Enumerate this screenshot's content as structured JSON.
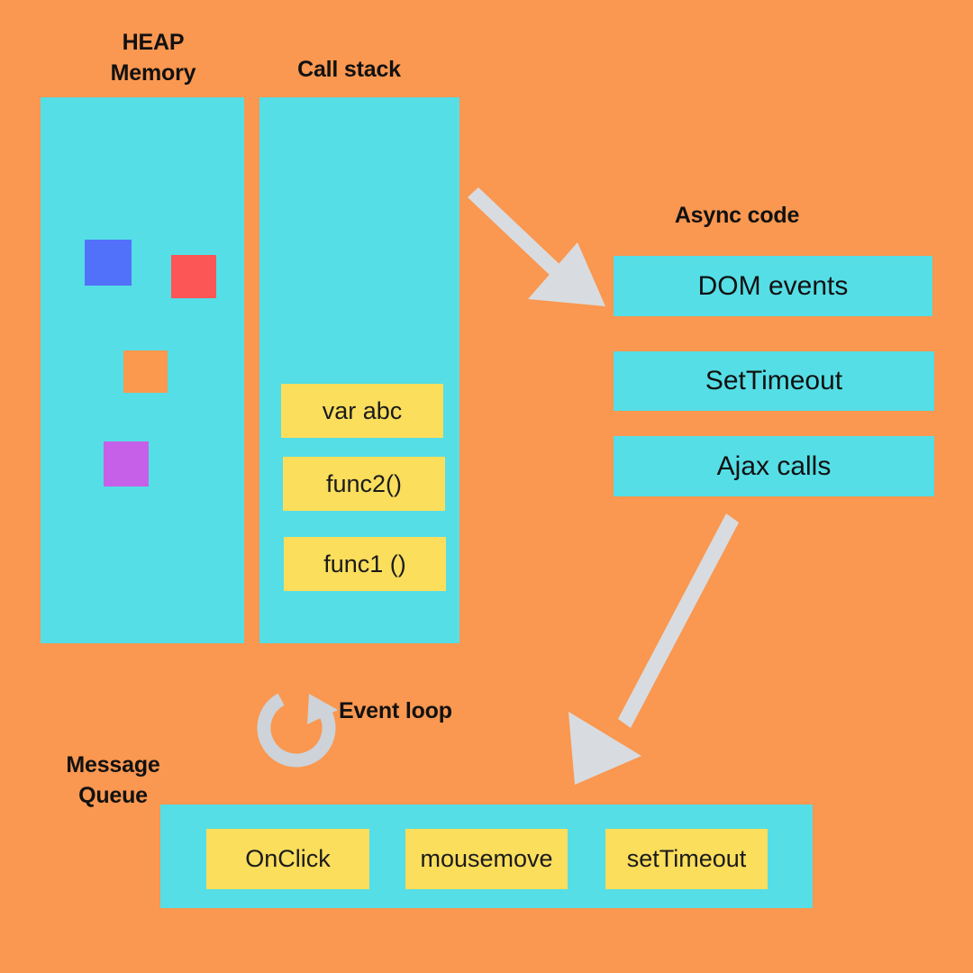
{
  "theme": {
    "background": "#FA9750",
    "panel": "#55DEE6",
    "chip": "#FADE5C",
    "arrow": "#D8DCE0",
    "loop_icon": "#CDD3D9",
    "text": "#111111"
  },
  "labels": {
    "heap": "HEAP\nMemory",
    "call_stack": "Call stack",
    "async_code": "Async code",
    "event_loop": "Event loop",
    "message_queue": "Message\nQueue"
  },
  "heap": {
    "blocks": [
      {
        "name": "blue-block",
        "color": "#5271FA"
      },
      {
        "name": "red-block",
        "color": "#FC5656"
      },
      {
        "name": "orange-block",
        "color": "#FB9A4F"
      },
      {
        "name": "purple-block",
        "color": "#C760E8"
      }
    ]
  },
  "call_stack": {
    "frames": [
      {
        "label": "var abc"
      },
      {
        "label": "func2()"
      },
      {
        "label": "func1 ()"
      }
    ]
  },
  "async_code": {
    "items": [
      {
        "label": "DOM events"
      },
      {
        "label": "SetTimeout"
      },
      {
        "label": "Ajax calls"
      }
    ]
  },
  "message_queue": {
    "items": [
      {
        "label": "OnClick"
      },
      {
        "label": "mousemove"
      },
      {
        "label": "setTimeout"
      }
    ]
  },
  "icons": {
    "event_loop": "refresh-loop-icon",
    "arrow_stack_to_async": "arrow-down-right-icon",
    "arrow_async_to_queue": "arrow-down-left-icon"
  }
}
